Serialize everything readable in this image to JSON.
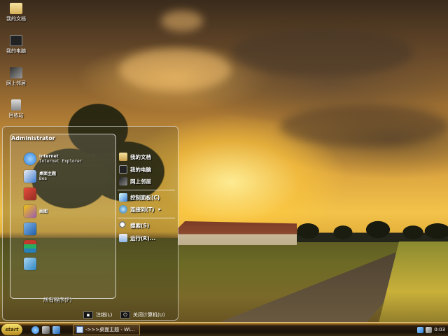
{
  "desktop": {
    "icons": [
      {
        "label": "我的文档",
        "icon": "folder-icon"
      },
      {
        "label": "我的电脑",
        "icon": "computer-icon"
      },
      {
        "label": "网上邻居",
        "icon": "network-icon"
      },
      {
        "label": "回收站",
        "icon": "recycle-bin-icon"
      }
    ]
  },
  "start_menu": {
    "user": "Administrator",
    "programs": [
      {
        "title": "Internet",
        "subtitle": "Internet Explorer",
        "icon": "internet-explorer-icon",
        "color": "#2a7fd8"
      },
      {
        "title": "桌面主题",
        "subtitle": "Bea",
        "icon": "theme-icon",
        "color": "#e8e8e8"
      },
      {
        "title": "",
        "subtitle": "",
        "icon": "media-player-icon",
        "color": "#c0392b"
      },
      {
        "title": "画图",
        "subtitle": "",
        "icon": "paint-icon",
        "color": "#9b59b6"
      },
      {
        "title": "",
        "subtitle": "",
        "icon": "messenger-icon",
        "color": "#3b86d0"
      },
      {
        "title": "",
        "subtitle": "",
        "icon": "winrar-icon",
        "color": "#8e44ad"
      },
      {
        "title": "",
        "subtitle": "",
        "icon": "tour-icon",
        "color": "#3498db"
      }
    ],
    "all_programs": "所有程序(P)",
    "right_items": [
      {
        "label": "我的文档",
        "icon": "documents-icon"
      },
      {
        "label": "我的电脑",
        "icon": "computer-icon"
      },
      {
        "label": "网上邻居",
        "icon": "network-icon"
      },
      {
        "label": "控制面板(C)",
        "icon": "control-panel-icon"
      },
      {
        "label": "连接到(T)",
        "icon": "connect-icon"
      },
      {
        "label": "搜索(S)",
        "icon": "search-icon"
      },
      {
        "label": "运行(R)...",
        "icon": "run-icon"
      }
    ],
    "logoff": "注销(L)",
    "shutdown": "关闭计算机(U)"
  },
  "taskbar": {
    "start_label": "start",
    "task_title": "->>>桌面主题 - Wi...",
    "clock": "0:03"
  },
  "colors": {
    "taskbar_accent": "#c9a04a",
    "start_button": "#f4e06a"
  }
}
